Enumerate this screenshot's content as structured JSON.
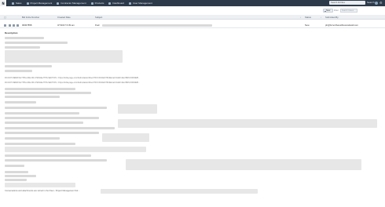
{
  "nav": {
    "logo": "N",
    "items": [
      {
        "label": "Sales"
      },
      {
        "label": "Project Management"
      },
      {
        "label": "Contractor Management"
      },
      {
        "label": "Products"
      },
      {
        "label": "Dashboard"
      },
      {
        "label": "User Management"
      }
    ],
    "search_placeholder": "Search All Files",
    "search_button": "Search"
  },
  "toolbar": {
    "button": "New",
    "link": "Filter",
    "field_placeholder": "Search Cases"
  },
  "table": {
    "columns": [
      "Bid Invite Number",
      "Created Date",
      "Subject",
      "Status",
      "Submitted By"
    ],
    "row": {
      "bid_number": "00007858",
      "created_date": "3/7/2017 6:39 am",
      "subject": "Fwd: ",
      "status": "New",
      "submitted_by": "ph@bcnorthwestfloorandwall.com"
    }
  },
  "description": {
    "label": "Description",
    "url_lines": [
      "DO-NOT-REMOVE-THIS-LINE-OR-CHANGE-THIS-SECTION: <https://bc9a.page.com/NetInvitation/Direct?ID=CF4CE2373F&Email=2ddd=4&o=BRCL5FD0E8f...",
      "DO-NOT-REMOVE-THIS-LINE-OR-CHANGE-THIS-SECTION: <https://bc9a.page.com/NetInvitation/Direct?ID=CF4CE2373F&Email=2ddd=4&o=BRCL5FD0E8f..."
    ],
    "closing": "Conversations and attachments are stored in the Fleet - Project Management Sof..."
  }
}
